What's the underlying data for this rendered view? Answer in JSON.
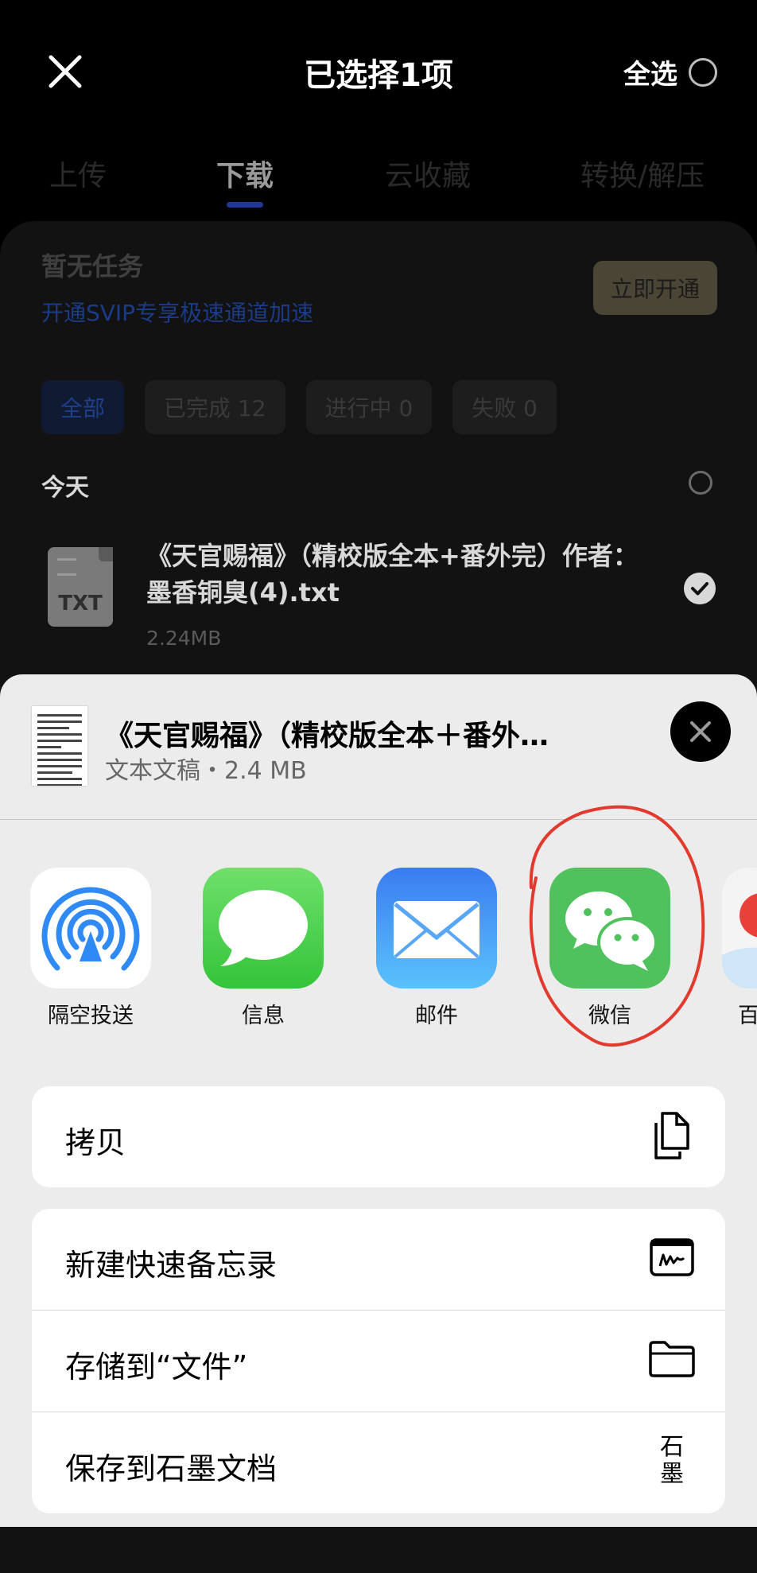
{
  "header": {
    "title": "已选择1项",
    "select_all": "全选"
  },
  "tabs": [
    {
      "label": "上传"
    },
    {
      "label": "下载",
      "active": true
    },
    {
      "label": "云收藏"
    },
    {
      "label": "转换/解压"
    }
  ],
  "promo": {
    "title": "暂无任务",
    "subtitle": "开通SVIP专享极速通道加速",
    "button": "立即开通"
  },
  "filters": [
    "全部",
    "已完成 12",
    "进行中 0",
    "失败 0"
  ],
  "section": {
    "title": "今天"
  },
  "file": {
    "name": "《天官赐福》（精校版全本+番外完）作者：墨香铜臭(4).txt",
    "size": "2.24MB",
    "icon_text": "TXT"
  },
  "share_sheet": {
    "title": "《天官赐福》（精校版全本＋番外…",
    "subtitle": "文本文稿・2.4 MB",
    "apps": [
      {
        "label": "隔空投送",
        "icon": "airdrop-icon"
      },
      {
        "label": "信息",
        "icon": "messages-icon"
      },
      {
        "label": "邮件",
        "icon": "mail-icon"
      },
      {
        "label": "微信",
        "icon": "wechat-icon"
      },
      {
        "label": "百",
        "icon": "baidu-netdisk-icon"
      }
    ],
    "actions": [
      {
        "label": "拷贝",
        "icon": "copy-icon"
      },
      {
        "label": "新建快速备忘录",
        "icon": "quick-note-icon"
      },
      {
        "label": "存储到“文件”",
        "icon": "folder-icon"
      },
      {
        "label": "保存到石墨文档",
        "icon": "shimo-icon",
        "icon_text": "石墨"
      }
    ]
  },
  "colors": {
    "annotation": "#e23a2f",
    "wechat": "#4fc25d",
    "link": "#1b3b86"
  }
}
